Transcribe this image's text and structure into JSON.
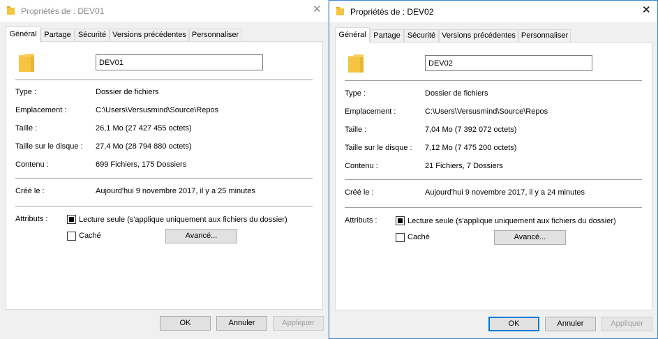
{
  "dialogs": [
    {
      "title": "Propriétés de : DEV01",
      "tabs": [
        "Général",
        "Partage",
        "Sécurité",
        "Versions précédentes",
        "Personnaliser"
      ],
      "name_value": "DEV01",
      "labels": {
        "type": "Type :",
        "location": "Emplacement :",
        "size": "Taille :",
        "size_on_disk": "Taille sur le disque :",
        "contents": "Contenu :",
        "created": "Créé le :",
        "attributes": "Attributs :"
      },
      "values": {
        "type": "Dossier de fichiers",
        "location": "C:\\Users\\Versusmind\\Source\\Repos",
        "size": "26,1 Mo (27 427 455 octets)",
        "size_on_disk": "27,4 Mo (28 794 880 octets)",
        "contents": "699 Fichiers, 175 Dossiers",
        "created": "Aujourd'hui 9 novembre 2017, il y a 25 minutes"
      },
      "readonly_label": "Lecture seule (s'applique uniquement aux fichiers du dossier)",
      "hidden_label": "Caché",
      "advanced_label": "Avancé...",
      "ok_label": "OK",
      "cancel_label": "Annuler",
      "apply_label": "Appliquer"
    },
    {
      "title": "Propriétés de : DEV02",
      "tabs": [
        "Général",
        "Partage",
        "Sécurité",
        "Versions précédentes",
        "Personnaliser"
      ],
      "name_value": "DEV02",
      "labels": {
        "type": "Type :",
        "location": "Emplacement :",
        "size": "Taille :",
        "size_on_disk": "Taille sur le disque :",
        "contents": "Contenu :",
        "created": "Créé le :",
        "attributes": "Attributs :"
      },
      "values": {
        "type": "Dossier de fichiers",
        "location": "C:\\Users\\Versusmind\\Source\\Repos",
        "size": "7,04 Mo (7 392 072 octets)",
        "size_on_disk": "7,12 Mo (7 475 200 octets)",
        "contents": "21 Fichiers, 7 Dossiers",
        "created": "Aujourd'hui 9 novembre 2017, il y a 24 minutes"
      },
      "readonly_label": "Lecture seule (s'applique uniquement aux fichiers du dossier)",
      "hidden_label": "Caché",
      "advanced_label": "Avancé...",
      "ok_label": "OK",
      "cancel_label": "Annuler",
      "apply_label": "Appliquer"
    }
  ],
  "close_glyph": "✕",
  "colors": {
    "active_border": "#3c87d4",
    "folder": "#f5c542",
    "default_button": "#0078d7"
  }
}
